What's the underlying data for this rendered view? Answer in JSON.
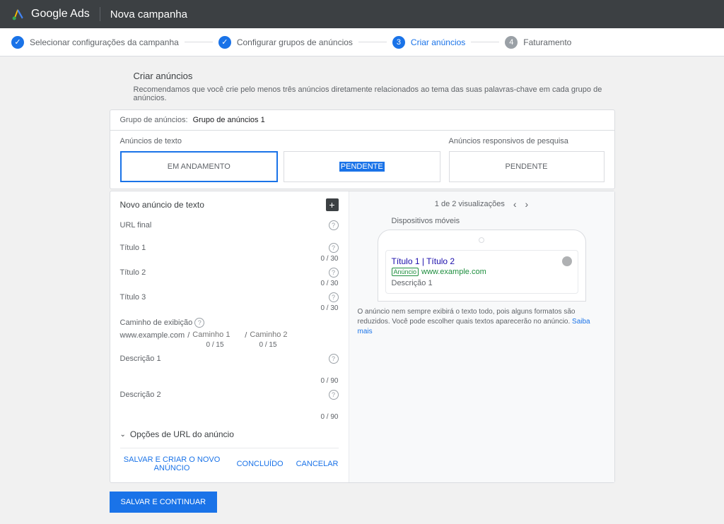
{
  "header": {
    "brand": "Google Ads",
    "campaign": "Nova campanha"
  },
  "stepper": {
    "step1": "Selecionar configurações da campanha",
    "step2": "Configurar grupos de anúncios",
    "step3": "Criar anúncios",
    "num3": "3",
    "step4": "Faturamento",
    "num4": "4"
  },
  "page": {
    "title": "Criar anúncios",
    "subtitle": "Recomendamos que você crie pelo menos três anúncios diretamente relacionados ao tema das suas palavras-chave em cada grupo de anúncios."
  },
  "group": {
    "label": "Grupo de anúncios:",
    "value": "Grupo de anúncios 1"
  },
  "types": {
    "text": "Anúncios de texto",
    "responsive": "Anúncios responsivos de pesquisa",
    "box1": "EM ANDAMENTO",
    "box2": "PENDENTE",
    "box3": "PENDENTE"
  },
  "form": {
    "title": "Novo anúncio de texto",
    "url": "URL final",
    "t1": "Título 1",
    "t2": "Título 2",
    "t3": "Título 3",
    "c30": "0 / 30",
    "path_label": "Caminho de exibição",
    "domain": "www.example.com",
    "slash": "/",
    "path1": "Caminho 1",
    "path2": "Caminho 2",
    "c15": "0 / 15",
    "d1": "Descrição 1",
    "d2": "Descrição 2",
    "c90": "0 / 90",
    "expand": "Opções de URL do anúncio",
    "help": "?"
  },
  "actions": {
    "save_new": "SALVAR E CRIAR O NOVO ANÚNCIO",
    "done": "CONCLUÍDO",
    "cancel": "CANCELAR"
  },
  "preview": {
    "count": "1 de 2 visualizações",
    "device": "Dispositivos móveis",
    "title": "Título 1 | Título 2",
    "badge": "Anúncio",
    "url": "www.example.com",
    "desc": "Descrição 1",
    "disclaimer": "O anúncio nem sempre exibirá o texto todo, pois alguns formatos são reduzidos. Você pode escolher quais textos aparecerão no anúncio. ",
    "learn": "Saiba mais"
  },
  "primary": "SALVAR E CONTINUAR"
}
